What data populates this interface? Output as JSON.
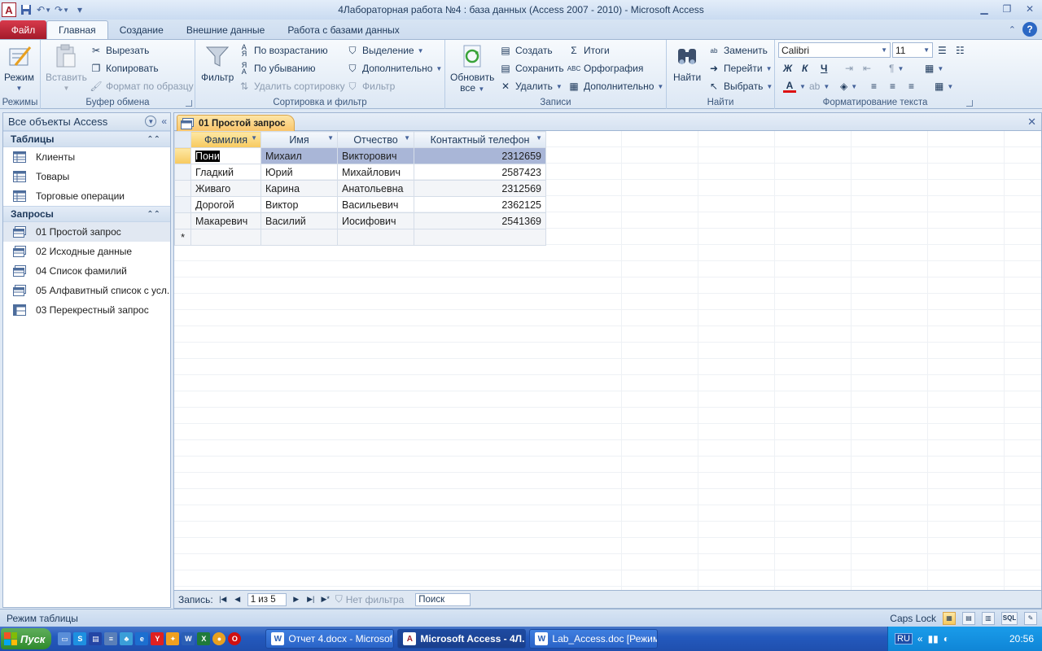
{
  "window": {
    "title": "4Лабораторная работа №4 : база данных (Access 2007 - 2010)  -  Microsoft Access",
    "app_icon_letter": "A"
  },
  "ribbon_tabs": [
    "Файл",
    "Главная",
    "Создание",
    "Внешние данные",
    "Работа с базами данных"
  ],
  "ribbon": {
    "views": {
      "mode_label": "Режим",
      "group": "Режимы"
    },
    "clipboard": {
      "paste": "Вставить",
      "cut": "Вырезать",
      "copy": "Копировать",
      "format_painter": "Формат по образцу",
      "group": "Буфер обмена"
    },
    "sort_filter": {
      "filter": "Фильтр",
      "ascending": "По возрастанию",
      "descending": "По убыванию",
      "remove_sort": "Удалить сортировку",
      "selection": "Выделение",
      "advanced": "Дополнительно",
      "toggle_filter": "Фильтр",
      "group": "Сортировка и фильтр"
    },
    "records": {
      "refresh_line1": "Обновить",
      "refresh_line2": "все",
      "new": "Создать",
      "save": "Сохранить",
      "delete": "Удалить",
      "totals": "Итоги",
      "spelling": "Орфография",
      "more": "Дополнительно",
      "group": "Записи"
    },
    "find": {
      "find": "Найти",
      "replace": "Заменить",
      "goto": "Перейти",
      "select": "Выбрать",
      "group": "Найти"
    },
    "text_format": {
      "font": "Calibri",
      "size": "11",
      "bold": "Ж",
      "italic": "К",
      "underline": "Ч",
      "group": "Форматирование текста"
    }
  },
  "nav_pane": {
    "title": "Все объекты Access",
    "sections": [
      {
        "name": "Таблицы",
        "items": [
          "Клиенты",
          "Товары",
          "Торговые операции"
        ]
      },
      {
        "name": "Запросы",
        "items": [
          "01 Простой запрос",
          "02 Исходные данные",
          "04 Список фамилий",
          "05 Алфавитный список с усл...",
          "03 Перекрестный запрос"
        ]
      }
    ]
  },
  "document": {
    "tab_title": "01 Простой запрос",
    "columns": [
      "Фамилия",
      "Имя",
      "Отчество",
      "Контактный телефон"
    ],
    "rows": [
      [
        "Пони",
        "Михаил",
        "Викторович",
        "2312659"
      ],
      [
        "Гладкий",
        "Юрий",
        "Михайлович",
        "2587423"
      ],
      [
        "Живаго",
        "Карина",
        "Анатольевна",
        "2312569"
      ],
      [
        "Дорогой",
        "Виктор",
        "Васильевич",
        "2362125"
      ],
      [
        "Макаревич",
        "Василий",
        "Иосифович",
        "2541369"
      ]
    ],
    "new_row_marker": "*"
  },
  "record_nav": {
    "label": "Запись:",
    "position": "1 из 5",
    "filter": "Нет фильтра",
    "search": "Поиск"
  },
  "status": {
    "mode": "Режим таблицы",
    "caps": "Caps Lock",
    "sql": "SQL"
  },
  "taskbar": {
    "start": "Пуск",
    "windows": [
      "Отчет 4.docx - Microsof...",
      "Microsoft Access - 4Л...",
      "Lab_Access.doc [Режим ..."
    ],
    "lang": "RU",
    "time": "20:56"
  },
  "colors": {
    "file_tab": "#c42b3c",
    "accent": "#f7c95e",
    "ribbon_bg": "#dce7f4"
  }
}
